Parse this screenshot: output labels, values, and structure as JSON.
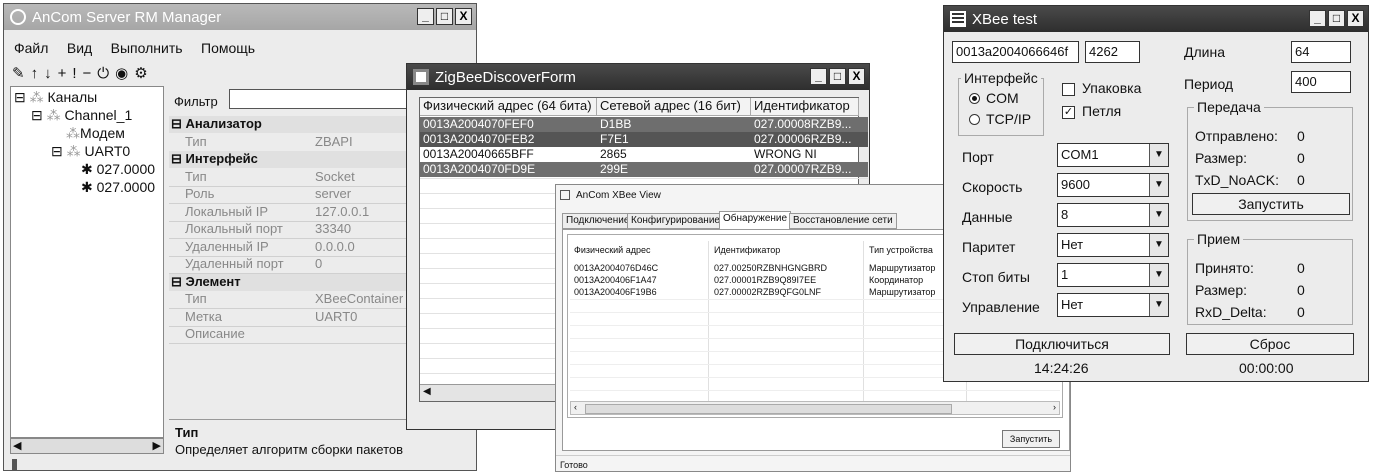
{
  "rm": {
    "title": "AnCom Server RM Manager",
    "menu": [
      "Файл",
      "Вид",
      "Выполнить",
      "Помощь"
    ],
    "tree": [
      "Каналы",
      "Channel_1",
      "Модем",
      "UART0",
      "027.0000",
      "027.0000"
    ],
    "filter_label": "Фильтр",
    "properties": [
      {
        "cat": "Анализатор"
      },
      {
        "k": "Тип",
        "v": "ZBAPI"
      },
      {
        "cat": "Интерфейс"
      },
      {
        "k": "Тип",
        "v": "Socket"
      },
      {
        "k": "Роль",
        "v": "server"
      },
      {
        "k": "Локальный IP",
        "v": "127.0.0.1"
      },
      {
        "k": "Локальный порт",
        "v": "33340"
      },
      {
        "k": "Удаленный IP",
        "v": "0.0.0.0"
      },
      {
        "k": "Удаленный порт",
        "v": "0"
      },
      {
        "cat": "Элемент"
      },
      {
        "k": "Тип",
        "v": "XBeeContainer"
      },
      {
        "k": "Метка",
        "v": "UART0"
      },
      {
        "k": "Описание",
        "v": ""
      }
    ],
    "desc_title": "Тип",
    "desc_text": "Определяет алгоритм сборки пакетов"
  },
  "zigbee": {
    "title": "ZigBeeDiscoverForm",
    "columns": [
      "Физический адрес (64 бита)",
      "Сетевой адрес (16 бит)",
      "Идентификатор"
    ],
    "rows": [
      [
        "0013A2004070FEF0",
        "D1BB",
        "027.00008RZB9..."
      ],
      [
        "0013A2004070FEB2",
        "F7E1",
        "027.00006RZB9..."
      ],
      [
        "0013A20040665BFF",
        "2865",
        "WRONG NI"
      ],
      [
        "0013A2004070FD9E",
        "299E",
        "027.00007RZB9..."
      ]
    ]
  },
  "xview": {
    "title": "AnCom XBee View",
    "tabs": [
      "Подключение",
      "Конфигурирование",
      "Обнаружение",
      "Восстановление сети"
    ],
    "columns": [
      "Физический адрес",
      "Идентификатор",
      "Тип устройства"
    ],
    "rows": [
      [
        "0013A2004076D46C",
        "027.00250RZBNHGNGBRD",
        "Маршрутизатор"
      ],
      [
        "0013A200406F1A47",
        "027.00001RZB9Q89I7EE",
        "Координатор"
      ],
      [
        "0013A200406F19B6",
        "027.00002RZB9QFG0LNF",
        "Маршрутизатор"
      ]
    ],
    "run_button": "Запустить",
    "status": "Готово"
  },
  "xtest": {
    "title": "XBee test",
    "address": "0013a2004066646f",
    "net_address": "4262",
    "length_label": "Длина",
    "length_value": "64",
    "period_label": "Период",
    "period_value": "400",
    "iface_group": "Интерфейс",
    "com_label": "COM",
    "tcp_label": "TCP/IP",
    "pack_label": "Упаковка",
    "loop_label": "Петля",
    "port_label": "Порт",
    "port_value": "COM1",
    "speed_label": "Скорость",
    "speed_value": "9600",
    "data_label": "Данные",
    "data_value": "8",
    "parity_label": "Паритет",
    "parity_value": "Нет",
    "stop_label": "Стоп биты",
    "stop_value": "1",
    "flow_label": "Управление",
    "flow_value": "Нет",
    "tx_group": "Передача",
    "sent_label": "Отправлено:",
    "sent_value": "0",
    "size_label": "Размер:",
    "size_value": "0",
    "noack_label": "TxD_NoACK:",
    "noack_value": "0",
    "start_button": "Запустить",
    "rx_group": "Прием",
    "recv_label": "Принято:",
    "recv_value": "0",
    "rsize_label": "Размер:",
    "rsize_value": "0",
    "delta_label": "RxD_Delta:",
    "delta_value": "0",
    "connect_button": "Подключиться",
    "reset_button": "Сброс",
    "clock": "14:24:26",
    "timer": "00:00:00"
  }
}
